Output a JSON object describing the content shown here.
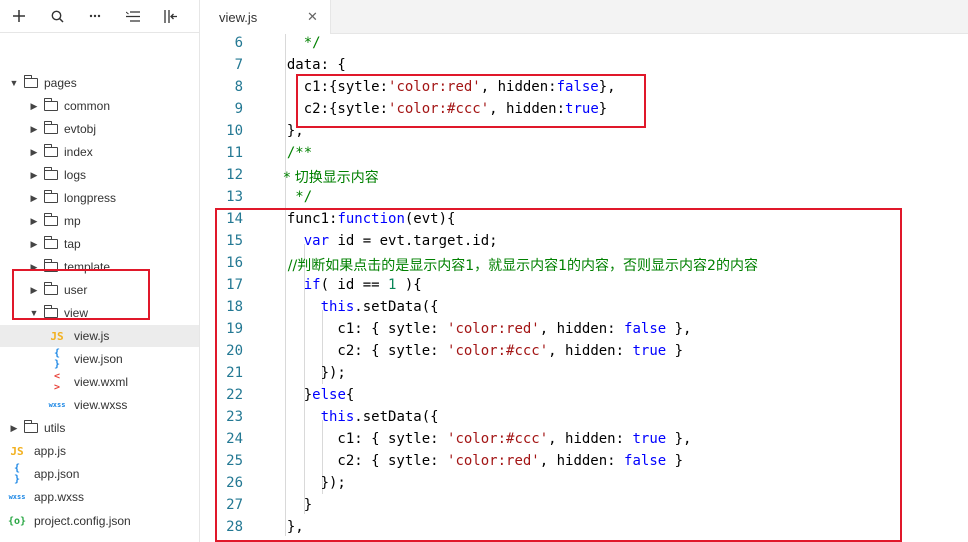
{
  "toolbar": {
    "icons": [
      "plus-icon",
      "search-icon",
      "more-icon",
      "collapse-icon",
      "split-icon"
    ]
  },
  "tree": [
    {
      "label": "pages",
      "type": "folder",
      "depth": 0,
      "open": true
    },
    {
      "label": "common",
      "type": "folder",
      "depth": 1,
      "open": false
    },
    {
      "label": "evtobj",
      "type": "folder",
      "depth": 1,
      "open": false
    },
    {
      "label": "index",
      "type": "folder",
      "depth": 1,
      "open": false
    },
    {
      "label": "logs",
      "type": "folder",
      "depth": 1,
      "open": false
    },
    {
      "label": "longpress",
      "type": "folder",
      "depth": 1,
      "open": false
    },
    {
      "label": "mp",
      "type": "folder",
      "depth": 1,
      "open": false
    },
    {
      "label": "tap",
      "type": "folder",
      "depth": 1,
      "open": false
    },
    {
      "label": "template",
      "type": "folder",
      "depth": 1,
      "open": false
    },
    {
      "label": "user",
      "type": "folder",
      "depth": 1,
      "open": false
    },
    {
      "label": "view",
      "type": "folder",
      "depth": 1,
      "open": true
    },
    {
      "label": "view.js",
      "type": "js",
      "depth": 2,
      "selected": true
    },
    {
      "label": "view.json",
      "type": "json",
      "depth": 2
    },
    {
      "label": "view.wxml",
      "type": "wxml",
      "depth": 2
    },
    {
      "label": "view.wxss",
      "type": "wxss",
      "depth": 2
    },
    {
      "label": "utils",
      "type": "folder",
      "depth": 0,
      "open": false
    },
    {
      "label": "app.js",
      "type": "js",
      "depth": 0
    },
    {
      "label": "app.json",
      "type": "json",
      "depth": 0
    },
    {
      "label": "app.wxss",
      "type": "wxss",
      "depth": 0
    },
    {
      "label": "project.config.json",
      "type": "cfg",
      "depth": 0
    }
  ],
  "file_icons": {
    "js": "JS",
    "json": "{ }",
    "wxml": "< >",
    "wxss": "wxss",
    "cfg": "{o}"
  },
  "tab": {
    "label": "view.js",
    "close": "✕"
  },
  "code": [
    {
      "n": "6",
      "t": [
        [
          "    */",
          "cm"
        ]
      ]
    },
    {
      "n": "7",
      "t": [
        [
          "  data: {",
          ""
        ]
      ]
    },
    {
      "n": "8",
      "t": [
        [
          "    c1:{sytle:",
          ""
        ],
        [
          "'color:red'",
          "str"
        ],
        [
          ", hidden:",
          ""
        ],
        [
          "false",
          "kw"
        ],
        [
          "},",
          ""
        ]
      ]
    },
    {
      "n": "9",
      "t": [
        [
          "    c2:{sytle:",
          ""
        ],
        [
          "'color:#ccc'",
          "str"
        ],
        [
          ", hidden:",
          ""
        ],
        [
          "true",
          "kw"
        ],
        [
          "}",
          ""
        ]
      ]
    },
    {
      "n": "10",
      "t": [
        [
          "  },",
          ""
        ]
      ]
    },
    {
      "n": "11",
      "t": [
        [
          "  /**",
          "cm"
        ]
      ]
    },
    {
      "n": "12",
      "t": [
        [
          "   * 切换显示内容",
          "cm"
        ]
      ]
    },
    {
      "n": "13",
      "t": [
        [
          "   */",
          "cm"
        ]
      ]
    },
    {
      "n": "14",
      "t": [
        [
          "  func1:",
          ""
        ],
        [
          "function",
          "kw"
        ],
        [
          "(evt){",
          ""
        ]
      ]
    },
    {
      "n": "15",
      "t": [
        [
          "    ",
          ""
        ],
        [
          "var",
          "kw"
        ],
        [
          " id = evt.target.id;",
          ""
        ]
      ]
    },
    {
      "n": "16",
      "t": [
        [
          "    //判断如果点击的是显示内容1，就显示内容1的内容，否则显示内容2的内容",
          "cm"
        ]
      ]
    },
    {
      "n": "17",
      "t": [
        [
          "    ",
          ""
        ],
        [
          "if",
          "kw"
        ],
        [
          "( id == ",
          ""
        ],
        [
          "1",
          "num"
        ],
        [
          " ){",
          ""
        ]
      ]
    },
    {
      "n": "18",
      "t": [
        [
          "      ",
          ""
        ],
        [
          "this",
          "kw"
        ],
        [
          ".setData({",
          ""
        ]
      ]
    },
    {
      "n": "19",
      "t": [
        [
          "        c1: { sytle: ",
          ""
        ],
        [
          "'color:red'",
          "str"
        ],
        [
          ", hidden: ",
          ""
        ],
        [
          "false",
          "kw"
        ],
        [
          " },",
          ""
        ]
      ]
    },
    {
      "n": "20",
      "t": [
        [
          "        c2: { sytle: ",
          ""
        ],
        [
          "'color:#ccc'",
          "str"
        ],
        [
          ", hidden: ",
          ""
        ],
        [
          "true",
          "kw"
        ],
        [
          " }",
          ""
        ]
      ]
    },
    {
      "n": "21",
      "t": [
        [
          "      });",
          ""
        ]
      ]
    },
    {
      "n": "22",
      "t": [
        [
          "    }",
          ""
        ],
        [
          "else",
          "kw"
        ],
        [
          "{",
          ""
        ]
      ]
    },
    {
      "n": "23",
      "t": [
        [
          "      ",
          ""
        ],
        [
          "this",
          "kw"
        ],
        [
          ".setData({",
          ""
        ]
      ]
    },
    {
      "n": "24",
      "t": [
        [
          "        c1: { sytle: ",
          ""
        ],
        [
          "'color:#ccc'",
          "str"
        ],
        [
          ", hidden: ",
          ""
        ],
        [
          "true",
          "kw"
        ],
        [
          " },",
          ""
        ]
      ]
    },
    {
      "n": "25",
      "t": [
        [
          "        c2: { sytle: ",
          ""
        ],
        [
          "'color:red'",
          "str"
        ],
        [
          ", hidden: ",
          ""
        ],
        [
          "false",
          "kw"
        ],
        [
          " }",
          ""
        ]
      ]
    },
    {
      "n": "26",
      "t": [
        [
          "      });",
          ""
        ]
      ]
    },
    {
      "n": "27",
      "t": [
        [
          "    }",
          ""
        ]
      ]
    },
    {
      "n": "28",
      "t": [
        [
          "  },",
          ""
        ]
      ]
    }
  ],
  "colors": {
    "highlight": "#e0182a",
    "keyword": "#0000ff",
    "string": "#a31515",
    "comment": "#008000",
    "number": "#098658",
    "line_number": "#237893"
  }
}
